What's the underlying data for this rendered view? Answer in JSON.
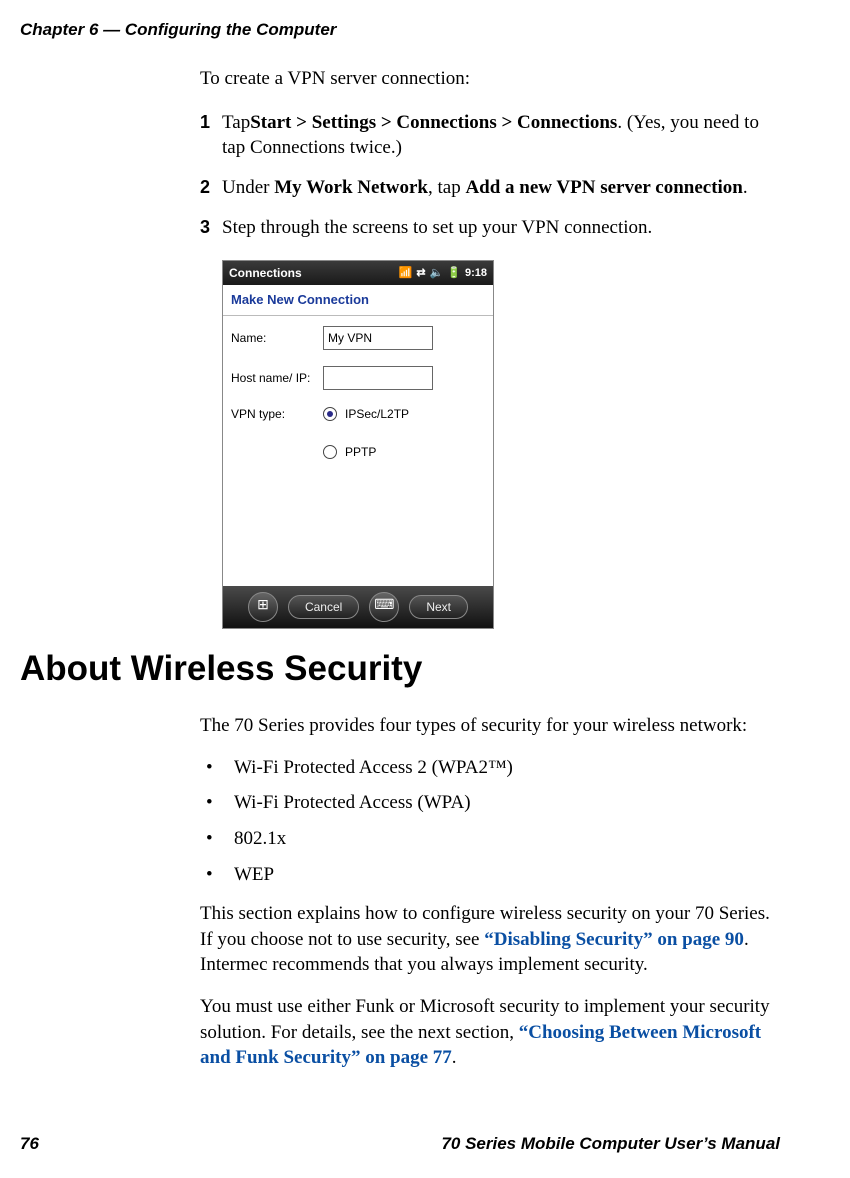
{
  "header": {
    "chapter": "Chapter 6 — Configuring the Computer"
  },
  "vpn": {
    "intro": "To create a VPN server connection:",
    "steps": {
      "s1": {
        "num": "1",
        "pre": "Tap",
        "bold": "Start > Settings > Connections > Connections",
        "post": ". (Yes, you need to tap Connections twice.)"
      },
      "s2": {
        "num": "2",
        "pre": "Under ",
        "bold1": "My Work Network",
        "mid": ", tap ",
        "bold2": "Add a new VPN server connection",
        "post": "."
      },
      "s3": {
        "num": "3",
        "text": "Step through the screens to set up your VPN connection."
      }
    }
  },
  "screenshot": {
    "title": "Connections",
    "time": "9:18",
    "subtitle": "Make New Connection",
    "labels": {
      "name": "Name:",
      "host": "Host name/ IP:",
      "vpntype": "VPN type:"
    },
    "fields": {
      "name_value": "My VPN",
      "host_value": ""
    },
    "radios": {
      "ipsec": "IPSec/L2TP",
      "pptp": "PPTP"
    },
    "buttons": {
      "cancel": "Cancel",
      "next": "Next"
    }
  },
  "wireless": {
    "heading": "About Wireless Security",
    "intro": "The 70 Series provides four types of security for your wireless network:",
    "bullets": {
      "b1": "Wi-Fi Protected Access 2 (WPA2™)",
      "b2": "Wi-Fi Protected Access (WPA)",
      "b3": "802.1x",
      "b4": "WEP"
    },
    "para1_pre": "This section explains how to configure wireless security on your 70 Series. If you choose not to use security, see ",
    "para1_xref": "“Disabling Security” on page 90",
    "para1_post": ". Intermec recommends that you always implement security.",
    "para2_pre": "You must use either Funk or Microsoft security to implement your security solution. For details, see the next section, ",
    "para2_xref": "“Choosing Between Microsoft and Funk Security” on page 77",
    "para2_post": "."
  },
  "footer": {
    "pagenum": "76",
    "title": "70 Series Mobile Computer User’s Manual"
  }
}
